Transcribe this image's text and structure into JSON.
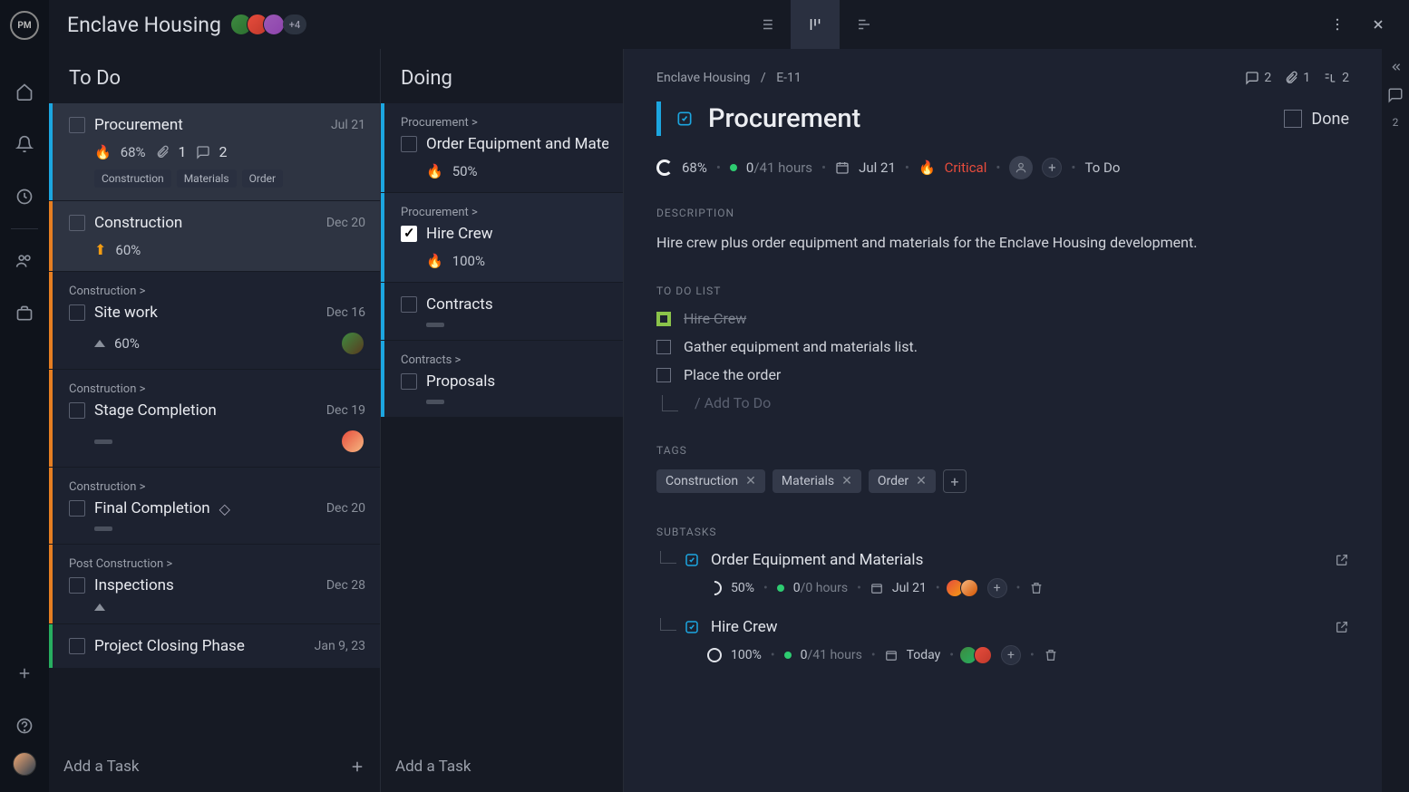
{
  "project": {
    "title": "Enclave Housing",
    "avatar_more": "+4"
  },
  "columns": {
    "todo": {
      "title": "To Do",
      "add_label": "Add a Task",
      "cards": [
        {
          "title": "Procurement",
          "date": "Jul 21",
          "pct": "68%",
          "attach": "1",
          "comments": "2",
          "tags": [
            "Construction",
            "Materials",
            "Order"
          ]
        },
        {
          "title": "Construction",
          "date": "Dec 20",
          "pct": "60%"
        },
        {
          "parent": "Construction >",
          "title": "Site work",
          "date": "Dec 16",
          "pct": "60%"
        },
        {
          "parent": "Construction >",
          "title": "Stage Completion",
          "date": "Dec 19"
        },
        {
          "parent": "Construction >",
          "title": "Final Completion",
          "date": "Dec 20"
        },
        {
          "parent": "Post Construction >",
          "title": "Inspections",
          "date": "Dec 28"
        },
        {
          "title": "Project Closing Phase",
          "date": "Jan 9, 23"
        }
      ]
    },
    "doing": {
      "title": "Doing",
      "add_label": "Add a Task",
      "cards": [
        {
          "parent": "Procurement >",
          "title": "Order Equipment and Materials",
          "pct": "50%"
        },
        {
          "parent": "Procurement >",
          "title": "Hire Crew",
          "pct": "100%"
        },
        {
          "title": "Contracts"
        },
        {
          "parent": "Contracts >",
          "title": "Proposals"
        }
      ]
    }
  },
  "detail": {
    "breadcrumb_project": "Enclave Housing",
    "breadcrumb_id": "E-11",
    "counts": {
      "comments": "2",
      "attachments": "1",
      "subtasks": "2"
    },
    "title": "Procurement",
    "done_label": "Done",
    "progress": "68%",
    "hours_used": "0",
    "hours_total": "/41 hours",
    "due": "Jul 21",
    "priority": "Critical",
    "status": "To Do",
    "description_label": "DESCRIPTION",
    "description": "Hire crew plus order equipment and materials for the Enclave Housing development.",
    "todo_label": "TO DO LIST",
    "todos": [
      {
        "label": "Hire Crew",
        "done": true
      },
      {
        "label": "Gather equipment and materials list.",
        "done": false
      },
      {
        "label": "Place the order",
        "done": false
      }
    ],
    "add_todo": "/ Add To Do",
    "tags_label": "TAGS",
    "tags": [
      "Construction",
      "Materials",
      "Order"
    ],
    "subtasks_label": "SUBTASKS",
    "subtasks": [
      {
        "title": "Order Equipment and Materials",
        "pct": "50%",
        "hours_used": "0",
        "hours_total": "/0 hours",
        "date": "Jul 21"
      },
      {
        "title": "Hire Crew",
        "pct": "100%",
        "hours_used": "0",
        "hours_total": "/41 hours",
        "date": "Today"
      }
    ]
  },
  "right_rail": {
    "comment_count": "2"
  }
}
